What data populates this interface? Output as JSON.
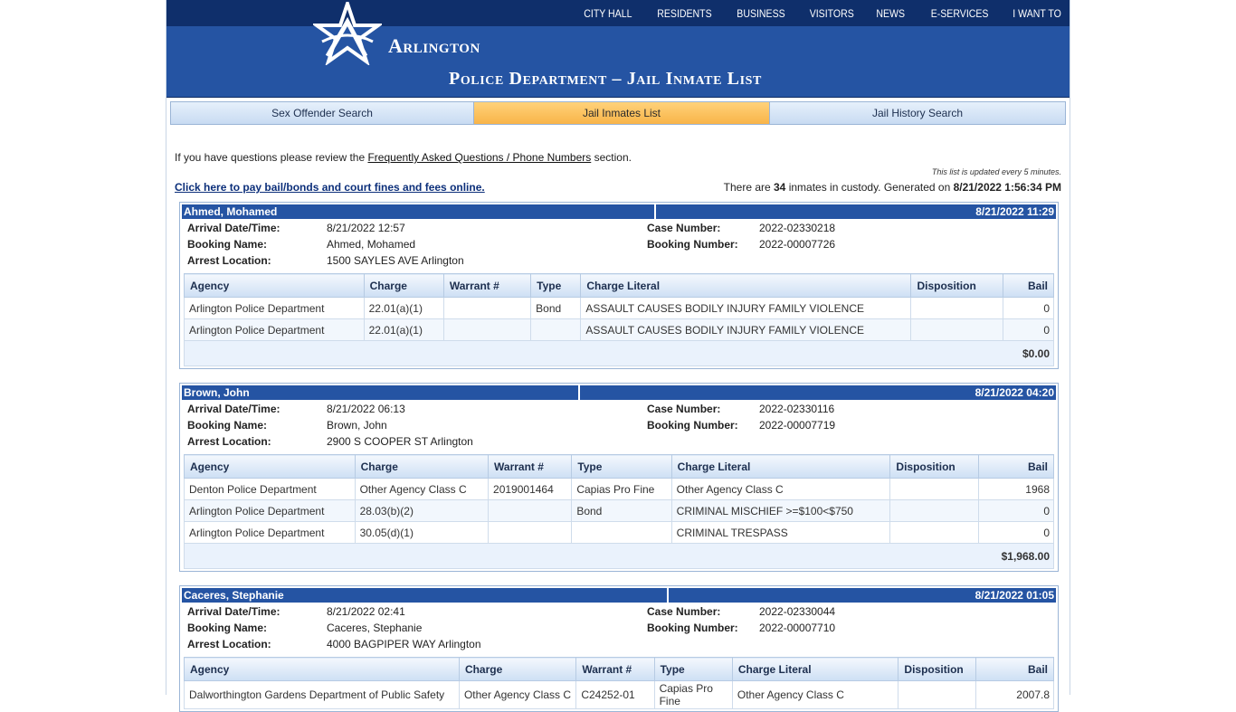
{
  "topnav": [
    "CITY HALL",
    "RESIDENTS",
    "BUSINESS",
    "VISITORS",
    "NEWS",
    "E-SERVICES",
    "I WANT TO"
  ],
  "logo_text": "Arlington",
  "page_heading": "Police Department – Jail Inmate List",
  "tabs": [
    {
      "label": "Sex Offender Search",
      "active": false
    },
    {
      "label": "Jail Inmates List",
      "active": true
    },
    {
      "label": "Jail History Search",
      "active": false
    }
  ],
  "intro": {
    "before": "If you have questions please review the ",
    "link": "Frequently Asked Questions / Phone Numbers",
    "after": " section."
  },
  "updated_note": "This list is updated every 5 minutes.",
  "pay_link": "Click here to pay bail/bonds and court fines and fees online.",
  "count": {
    "prefix": "There are ",
    "number": "34",
    "middle": " inmates in custody. Generated on ",
    "generated": "8/21/2022 1:56:34 PM"
  },
  "labels": {
    "arrival": "Arrival Date/Time:",
    "booking_name": "Booking Name:",
    "arrest_location": "Arrest Location:",
    "case_number": "Case Number:",
    "booking_number": "Booking Number:"
  },
  "columns": [
    "Agency",
    "Charge",
    "Warrant #",
    "Type",
    "Charge Literal",
    "Disposition",
    "Bail"
  ],
  "inmates": [
    {
      "name": "Ahmed, Mohamed",
      "date": "8/21/2022 11:29",
      "arrival": "8/21/2022 12:57",
      "booking_name": "Ahmed, Mohamed",
      "arrest_location": "1500 SAYLES AVE Arlington",
      "case_number": "2022-02330218",
      "booking_number": "2022-00007726",
      "charges": [
        [
          "Arlington Police Department",
          "22.01(a)(1)",
          "",
          "Bond",
          "ASSAULT CAUSES BODILY INJURY FAMILY VIOLENCE",
          "",
          "0"
        ],
        [
          "Arlington Police Department",
          "22.01(a)(1)",
          "",
          "",
          "ASSAULT CAUSES BODILY INJURY FAMILY VIOLENCE",
          "",
          "0"
        ]
      ],
      "total": "$0.00"
    },
    {
      "name": "Brown, John",
      "date": "8/21/2022 04:20",
      "arrival": "8/21/2022 06:13",
      "booking_name": "Brown, John",
      "arrest_location": "2900 S COOPER ST Arlington",
      "case_number": "2022-02330116",
      "booking_number": "2022-00007719",
      "charges": [
        [
          "Denton Police Department",
          "Other Agency Class C",
          "2019001464",
          "Capias Pro Fine",
          "Other Agency Class C",
          "",
          "1968"
        ],
        [
          "Arlington Police Department",
          "28.03(b)(2)",
          "",
          "Bond",
          "CRIMINAL MISCHIEF >=$100<$750",
          "",
          "0"
        ],
        [
          "Arlington Police Department",
          "30.05(d)(1)",
          "",
          "",
          "CRIMINAL TRESPASS",
          "",
          "0"
        ]
      ],
      "total": "$1,968.00"
    },
    {
      "name": "Caceres, Stephanie",
      "date": "8/21/2022 01:05",
      "arrival": "8/21/2022 02:41",
      "booking_name": "Caceres, Stephanie",
      "arrest_location": "4000 BAGPIPER WAY Arlington",
      "case_number": "2022-02330044",
      "booking_number": "2022-00007710",
      "charges": [
        [
          "Dalworthington Gardens Department of Public Safety",
          "Other Agency Class C",
          "C24252-01",
          "Capias Pro Fine",
          "Other Agency Class C",
          "",
          "2007.8"
        ]
      ],
      "total": ""
    }
  ]
}
